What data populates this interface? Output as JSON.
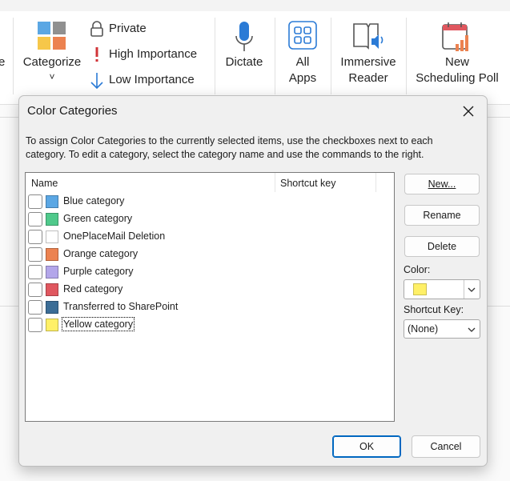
{
  "ribbon": {
    "categorize": {
      "label": "Categorize",
      "chevron": "˅"
    },
    "private": {
      "label": "Private"
    },
    "high_importance": {
      "label": "High Importance"
    },
    "low_importance": {
      "label": "Low Importance"
    },
    "dictate": {
      "label": "Dictate"
    },
    "all_apps": {
      "line1": "All",
      "line2": "Apps"
    },
    "immersive_reader": {
      "line1": "Immersive",
      "line2": "Reader"
    },
    "new_poll": {
      "line1": "New",
      "line2": "Scheduling Poll"
    },
    "left_cut": {
      "label": "e"
    }
  },
  "dialog": {
    "title": "Color Categories",
    "description": "To assign Color Categories to the currently selected items, use the checkboxes next to each category.  To edit a category, select the category name and use the commands to the right.",
    "columns": {
      "name": "Name",
      "shortcut": "Shortcut key"
    },
    "categories": [
      {
        "label": "Blue category",
        "color": "#5ba7e4",
        "checked": false
      },
      {
        "label": "Green category",
        "color": "#4fc98b",
        "checked": false
      },
      {
        "label": "OnePlaceMail Deletion",
        "color": "#ffffff",
        "checked": false
      },
      {
        "label": "Orange category",
        "color": "#ec8250",
        "checked": false
      },
      {
        "label": "Purple category",
        "color": "#b3a6ea",
        "checked": false
      },
      {
        "label": "Red category",
        "color": "#e0575f",
        "checked": false
      },
      {
        "label": "Transferred to SharePoint",
        "color": "#3b6d96",
        "checked": false
      },
      {
        "label": "Yellow category",
        "color": "#fff067",
        "checked": false,
        "selected": true
      }
    ],
    "buttons": {
      "new_label": "New...",
      "rename_label": "Rename",
      "delete_label": "Delete",
      "ok_label": "OK",
      "cancel_label": "Cancel"
    },
    "color_label": "Color:",
    "selected_color": "#fff067",
    "shortcut_key_label": "Shortcut Key:",
    "shortcut_key_value": "(None)"
  }
}
